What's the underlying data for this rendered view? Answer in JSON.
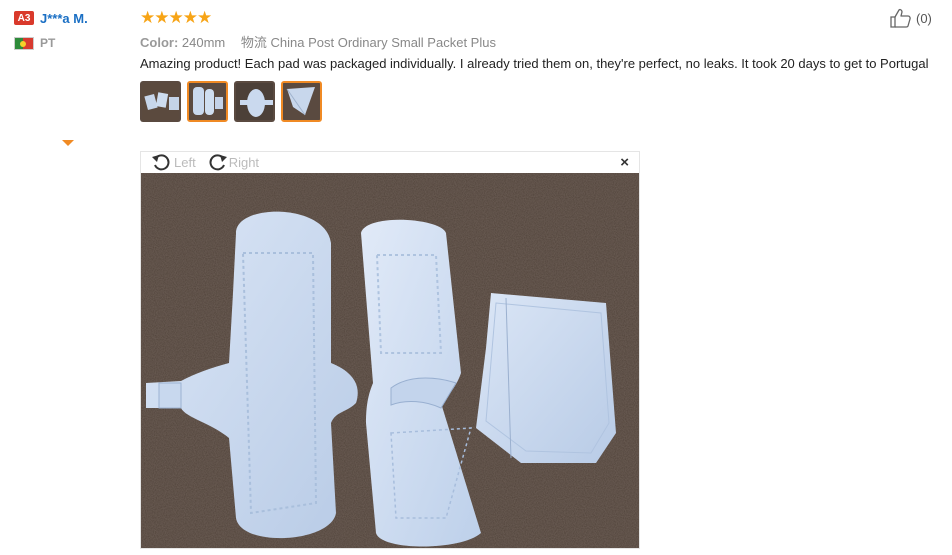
{
  "user": {
    "level_badge": "A3",
    "name": "J***a M.",
    "country_code": "PT"
  },
  "review": {
    "rating": 5,
    "color_label": "Color:",
    "color_value": "240mm",
    "shipping_label": "物流",
    "shipping_value": "China Post Ordinary Small Packet Plus",
    "text": "Amazing product! Each pad was packaged individually. I already tried them on, they're perfect, no leaks. It took 20 days to get to Portugal"
  },
  "like": {
    "count": "(0)"
  },
  "viewer": {
    "rotate_left": "Left",
    "rotate_right": "Right",
    "close": "×"
  },
  "icons": {
    "like": "thumbs-up-icon",
    "rotate_left": "rotate-left-icon",
    "rotate_right": "rotate-right-icon",
    "close": "close-icon",
    "star": "star-icon"
  },
  "colors": {
    "accent": "#f08a24",
    "star": "#f7a416",
    "link": "#1a6fc4",
    "badge": "#d9392b"
  }
}
